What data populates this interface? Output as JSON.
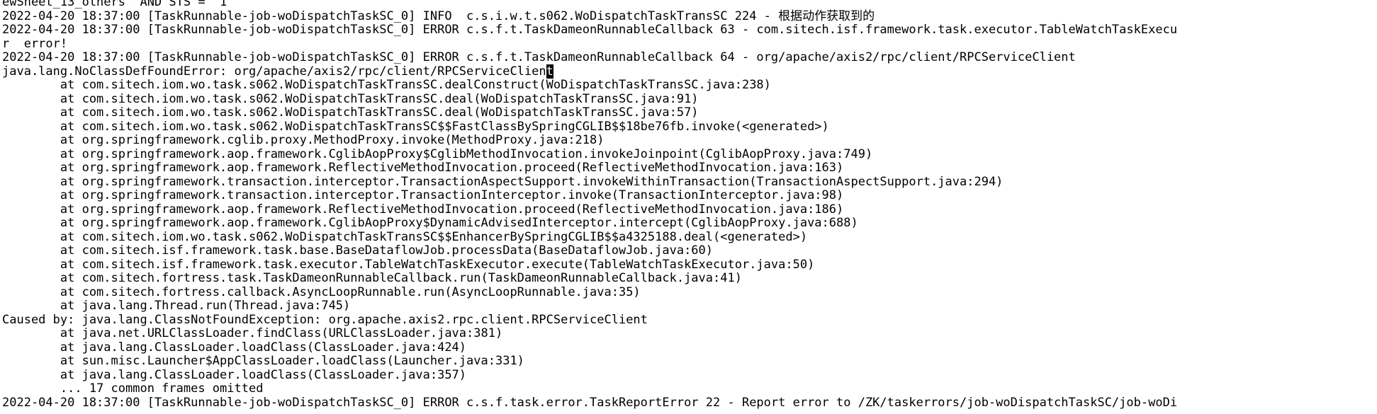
{
  "terminal": {
    "lines": [
      "ewSheet_13_others' AND STS = '1'",
      "2022-04-20 18:37:00 [TaskRunnable-job-woDispatchTaskSC_0] INFO  c.s.i.w.t.s062.WoDispatchTaskTransSC 224 - 根据动作获取到的",
      "2022-04-20 18:37:00 [TaskRunnable-job-woDispatchTaskSC_0] ERROR c.s.f.t.TaskDameonRunnableCallback 63 - com.sitech.isf.framework.task.executor.TableWatchTaskExecu",
      "r  error!",
      "2022-04-20 18:37:00 [TaskRunnable-job-woDispatchTaskSC_0] ERROR c.s.f.t.TaskDameonRunnableCallback 64 - org/apache/axis2/rpc/client/RPCServiceClient",
      "java.lang.NoClassDefFoundError: org/apache/axis2/rpc/client/RPCServiceClien",
      "        at com.sitech.iom.wo.task.s062.WoDispatchTaskTransSC.dealConstruct(WoDispatchTaskTransSC.java:238)",
      "        at com.sitech.iom.wo.task.s062.WoDispatchTaskTransSC.deal(WoDispatchTaskTransSC.java:91)",
      "        at com.sitech.iom.wo.task.s062.WoDispatchTaskTransSC.deal(WoDispatchTaskTransSC.java:57)",
      "        at com.sitech.iom.wo.task.s062.WoDispatchTaskTransSC$$FastClassBySpringCGLIB$$18be76fb.invoke(<generated>)",
      "        at org.springframework.cglib.proxy.MethodProxy.invoke(MethodProxy.java:218)",
      "        at org.springframework.aop.framework.CglibAopProxy$CglibMethodInvocation.invokeJoinpoint(CglibAopProxy.java:749)",
      "        at org.springframework.aop.framework.ReflectiveMethodInvocation.proceed(ReflectiveMethodInvocation.java:163)",
      "        at org.springframework.transaction.interceptor.TransactionAspectSupport.invokeWithinTransaction(TransactionAspectSupport.java:294)",
      "        at org.springframework.transaction.interceptor.TransactionInterceptor.invoke(TransactionInterceptor.java:98)",
      "        at org.springframework.aop.framework.ReflectiveMethodInvocation.proceed(ReflectiveMethodInvocation.java:186)",
      "        at org.springframework.aop.framework.CglibAopProxy$DynamicAdvisedInterceptor.intercept(CglibAopProxy.java:688)",
      "        at com.sitech.iom.wo.task.s062.WoDispatchTaskTransSC$$EnhancerBySpringCGLIB$$a4325188.deal(<generated>)",
      "        at com.sitech.isf.framework.task.base.BaseDataflowJob.processData(BaseDataflowJob.java:60)",
      "        at com.sitech.isf.framework.task.executor.TableWatchTaskExecutor.execute(TableWatchTaskExecutor.java:50)",
      "        at com.sitech.fortress.task.TaskDameonRunnableCallback.run(TaskDameonRunnableCallback.java:41)",
      "        at com.sitech.fortress.callback.AsyncLoopRunnable.run(AsyncLoopRunnable.java:35)",
      "        at java.lang.Thread.run(Thread.java:745)",
      "Caused by: java.lang.ClassNotFoundException: org.apache.axis2.rpc.client.RPCServiceClient",
      "        at java.net.URLClassLoader.findClass(URLClassLoader.java:381)",
      "        at java.lang.ClassLoader.loadClass(ClassLoader.java:424)",
      "        at sun.misc.Launcher$AppClassLoader.loadClass(Launcher.java:331)",
      "        at java.lang.ClassLoader.loadClass(ClassLoader.java:357)",
      "        ... 17 common frames omitted",
      "2022-04-20 18:37:00 [TaskRunnable-job-woDispatchTaskSC_0] ERROR c.s.f.task.error.TaskReportError 22 - Report error to /ZK/taskerrors/job-woDispatchTaskSC/job-woDi"
    ],
    "cursor_line_index": 5,
    "cursor_char": "t"
  }
}
